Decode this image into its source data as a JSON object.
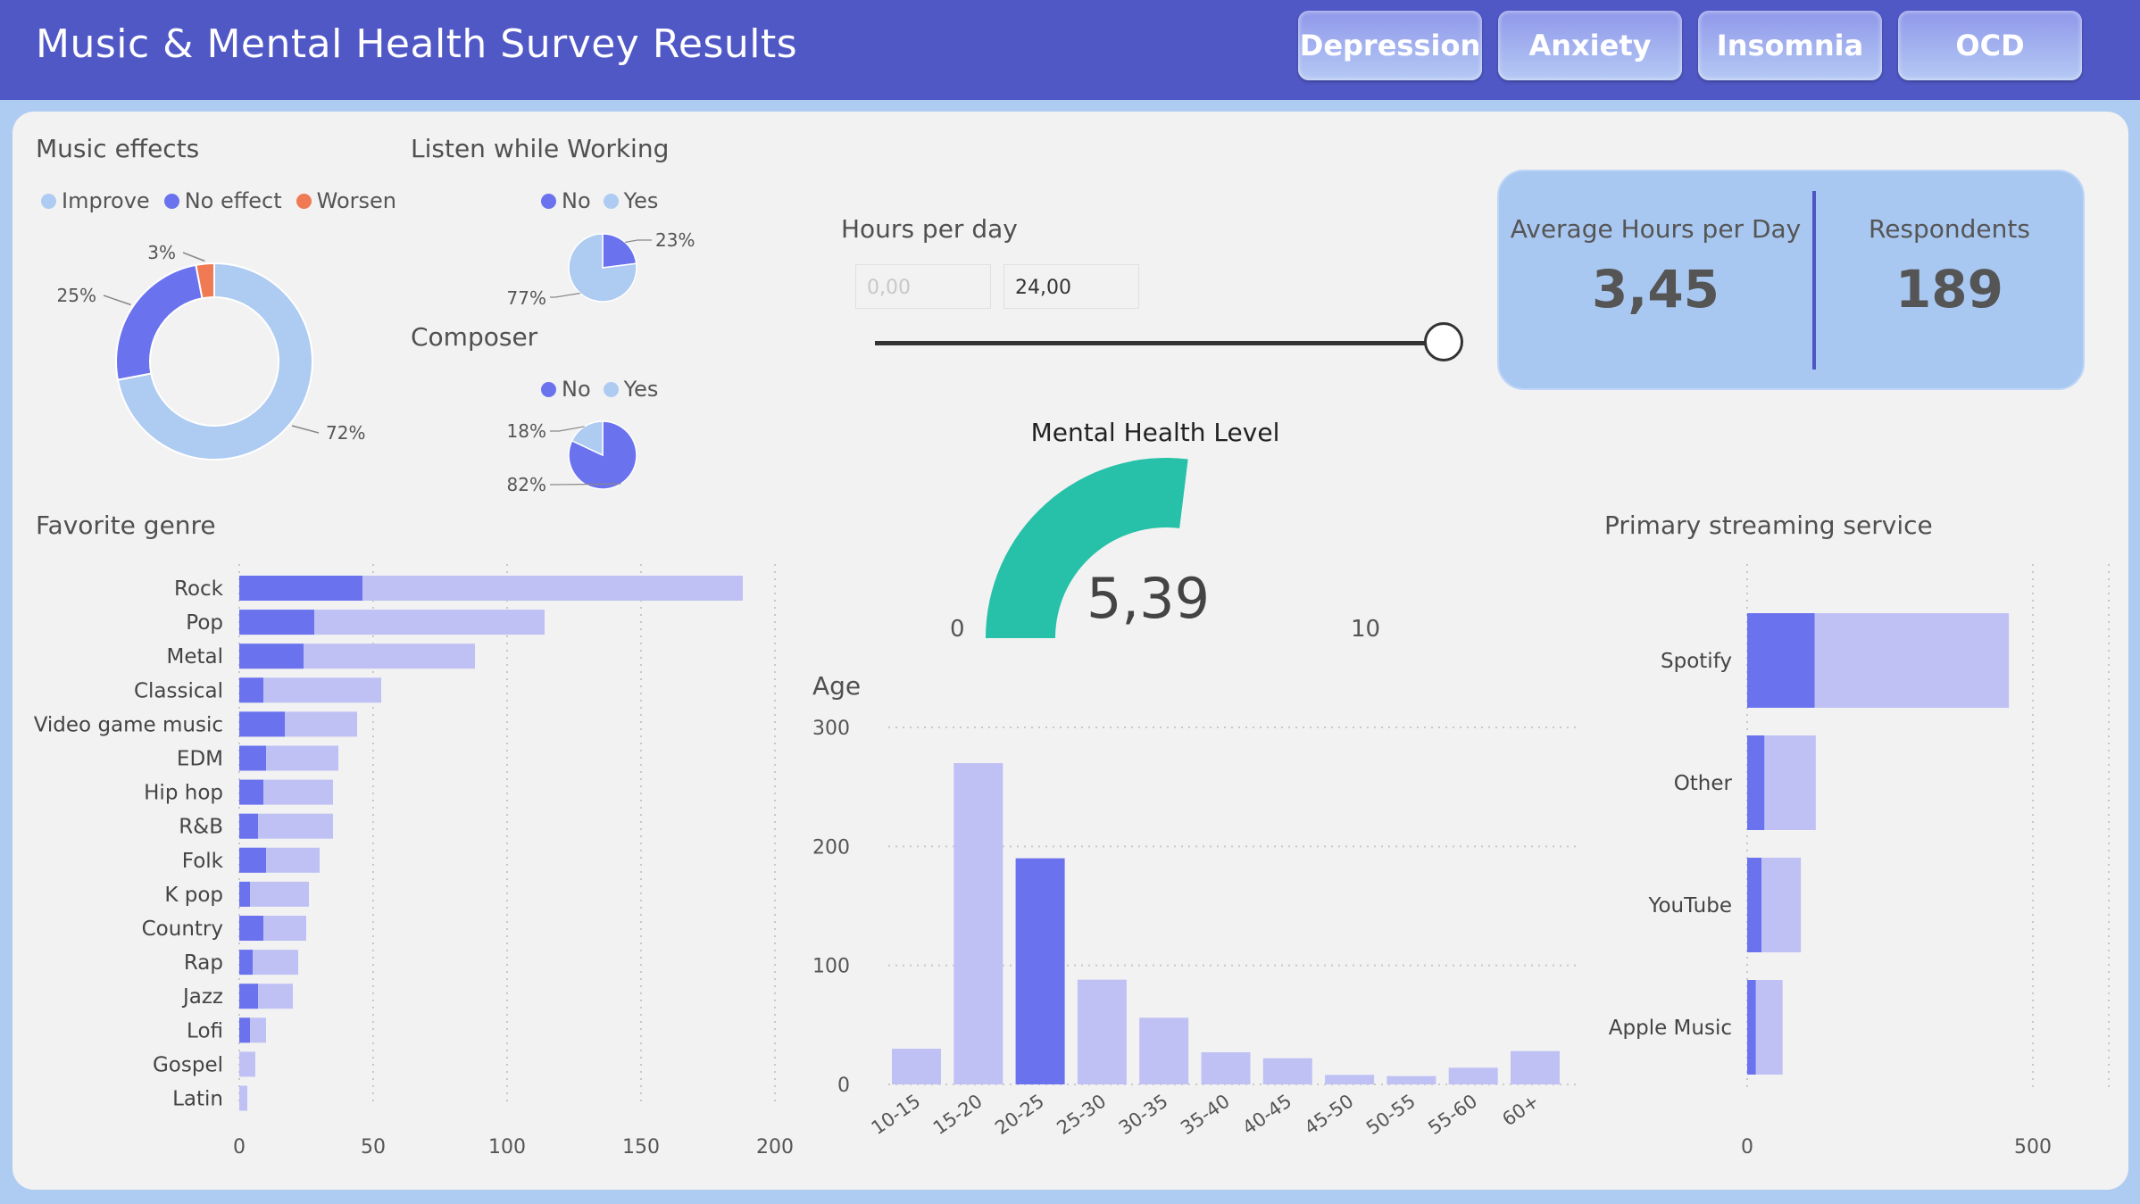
{
  "header": {
    "title": "Music & Mental Health Survey Results",
    "tabs": [
      "Depression",
      "Anxiety",
      "Insomnia",
      "OCD"
    ]
  },
  "colors": {
    "light": "#aecbf2",
    "dark": "#6b72ee",
    "orange": "#f07a53",
    "teal": "#26c1a8",
    "bar_light": "#bfc1f4"
  },
  "music_effects": {
    "title": "Music effects",
    "legend": [
      "Improve",
      "No effect",
      "Worsen"
    ],
    "chart_data": {
      "type": "pie",
      "categories": [
        "Improve",
        "No effect",
        "Worsen"
      ],
      "values": [
        72,
        25,
        3
      ],
      "labels": [
        "72%",
        "25%",
        "3%"
      ]
    }
  },
  "listen_working": {
    "title": "Listen while Working",
    "legend": [
      "No",
      "Yes"
    ],
    "chart_data": {
      "type": "pie",
      "categories": [
        "No",
        "Yes"
      ],
      "values": [
        23,
        77
      ],
      "labels": [
        "23%",
        "77%"
      ]
    }
  },
  "composer": {
    "title": "Composer",
    "legend": [
      "No",
      "Yes"
    ],
    "chart_data": {
      "type": "pie",
      "categories": [
        "No",
        "Yes"
      ],
      "values": [
        82,
        18
      ],
      "labels": [
        "82%",
        "18%"
      ]
    }
  },
  "hours_slider": {
    "title": "Hours per day",
    "min_value": "0,00",
    "max_value": "24,00",
    "selected_fraction": 1.0
  },
  "kpis": {
    "avg_label": "Average Hours per Day",
    "avg_value": "3,45",
    "resp_label": "Respondents",
    "resp_value": "189"
  },
  "gauge": {
    "title": "Mental Health Level",
    "value_text": "5,39",
    "min_label": "0",
    "max_label": "10",
    "chart_data": {
      "type": "gauge",
      "value": 5.39,
      "min": 0,
      "max": 10
    }
  },
  "favorite_genre": {
    "title": "Favorite genre",
    "chart_data": {
      "type": "bar",
      "categories": [
        "Rock",
        "Pop",
        "Metal",
        "Classical",
        "Video game music",
        "EDM",
        "Hip hop",
        "R&B",
        "Folk",
        "K pop",
        "Country",
        "Rap",
        "Jazz",
        "Lofi",
        "Gospel",
        "Latin"
      ],
      "series": [
        {
          "values": [
            188,
            114,
            88,
            53,
            44,
            37,
            35,
            35,
            30,
            26,
            25,
            22,
            20,
            10,
            6,
            3
          ]
        },
        {
          "values": [
            46,
            28,
            24,
            9,
            17,
            10,
            9,
            7,
            10,
            4,
            9,
            5,
            7,
            4,
            0,
            0
          ]
        }
      ],
      "xticks": [
        "0",
        "50",
        "100",
        "150",
        "200"
      ],
      "xlim": [
        0,
        200
      ]
    }
  },
  "age": {
    "title": "Age",
    "chart_data": {
      "type": "bar",
      "categories": [
        "10-15",
        "15-20",
        "20-25",
        "25-30",
        "30-35",
        "35-40",
        "40-45",
        "45-50",
        "50-55",
        "55-60",
        "60+"
      ],
      "values": [
        30,
        270,
        190,
        88,
        56,
        27,
        22,
        8,
        7,
        14,
        28
      ],
      "highlight_index": 2,
      "yticks": [
        "0",
        "100",
        "200",
        "300"
      ],
      "ylim": [
        0,
        300
      ]
    }
  },
  "streaming": {
    "title": "Primary streaming service",
    "chart_data": {
      "type": "bar",
      "categories": [
        "Spotify",
        "Other",
        "YouTube",
        "Apple Music"
      ],
      "series": [
        {
          "values": [
            458,
            120,
            94,
            62
          ]
        },
        {
          "values": [
            118,
            30,
            25,
            15
          ]
        }
      ],
      "xticks": [
        "0",
        "500"
      ],
      "xlim": [
        0,
        500
      ]
    }
  }
}
